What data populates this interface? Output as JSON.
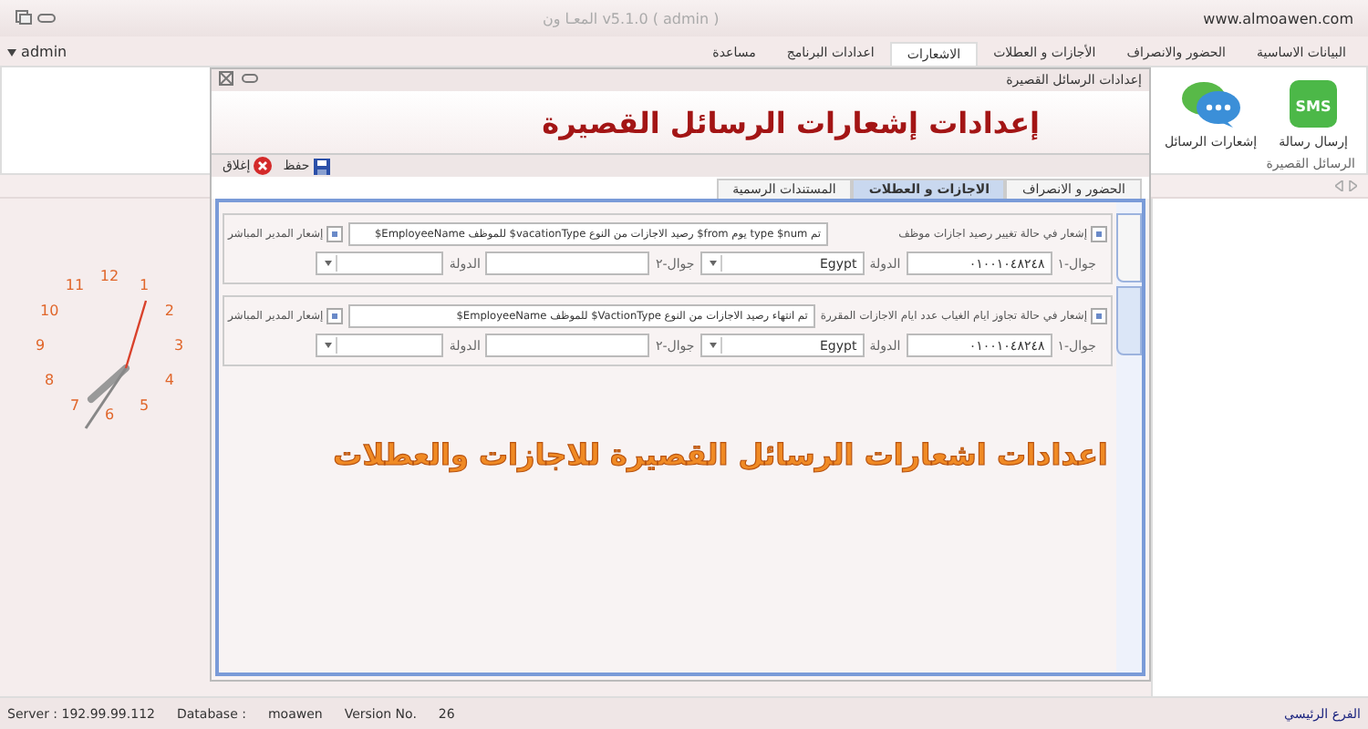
{
  "window": {
    "title": "المعـا ون v5.1.0 ( admin )",
    "site": "www.almoawen.com"
  },
  "user": "admin",
  "menu_tabs": [
    {
      "label": "البيانات الاساسية",
      "selected": false
    },
    {
      "label": "الحضور والانصراف",
      "selected": false
    },
    {
      "label": "الأجازات و العطلات",
      "selected": false
    },
    {
      "label": "الاشعارات",
      "selected": true
    },
    {
      "label": "اعدادات البرنامج",
      "selected": false
    },
    {
      "label": "مساعدة",
      "selected": false
    }
  ],
  "ribbon": {
    "buttons": [
      {
        "label": "إرسال رسالة",
        "kind": "sms",
        "icon_text": "SMS"
      },
      {
        "label": "إشعارات الرسائل",
        "kind": "chat"
      }
    ],
    "group_label": "الرسائل القصيرة"
  },
  "clock": {
    "numbers": [
      "12",
      "1",
      "2",
      "3",
      "4",
      "5",
      "6",
      "7",
      "8",
      "9",
      "10",
      "11"
    ]
  },
  "dialog": {
    "title": "إعدادات الرسائل القصيرة",
    "heading": "إعدادات إشعارات الرسائل القصيرة",
    "toolbar": [
      {
        "label": "حفظ",
        "kind": "save"
      },
      {
        "label": "إغلاق",
        "kind": "close"
      }
    ],
    "tabs": [
      {
        "label": "الحضور و الانصراف",
        "selected": false
      },
      {
        "label": "الاجازات و العطلات",
        "selected": true
      },
      {
        "label": "المستندات الرسمية",
        "selected": false
      }
    ],
    "notifications": [
      {
        "checked": true,
        "label": "إشعار في حالة تغيير رصيد اجازات موظف",
        "message": "تم type $num يوم from$ رصيد الاجازات من النوع vacationType$ للموظف EmployeeName$",
        "manager_checked": true,
        "manager_label": "إشعار المدير المباشر",
        "phone1_label": "جوال-١",
        "phone1": "٠١٠٠١٠٤٨٢٤٨",
        "country1_label": "الدولة",
        "country1": "Egypt",
        "phone2_label": "جوال-٢",
        "country2_label": "الدولة"
      },
      {
        "checked": true,
        "label": "إشعار في حالة تجاوز ايام الغياب عدد ايام الاجازات المقررة",
        "message": "تم انتهاء رصيد الاجازات من النوع VactionType$ للموظف EmployeeName$",
        "manager_checked": true,
        "manager_label": "إشعار المدير المباشر",
        "phone1_label": "جوال-١",
        "phone1": "٠١٠٠١٠٤٨٢٤٨",
        "country1_label": "الدولة",
        "country1": "Egypt",
        "phone2_label": "جوال-٢",
        "country2_label": "الدولة"
      }
    ]
  },
  "caption": "اعدادات اشعارات الرسائل القصيرة للاجازات والعطلات",
  "status_bar": {
    "server": "Server :  192.99.99.112",
    "database_label": "Database :",
    "database": "moawen",
    "version_label": "Version No.",
    "version": "26",
    "branch": "الفرع الرئيسي"
  }
}
